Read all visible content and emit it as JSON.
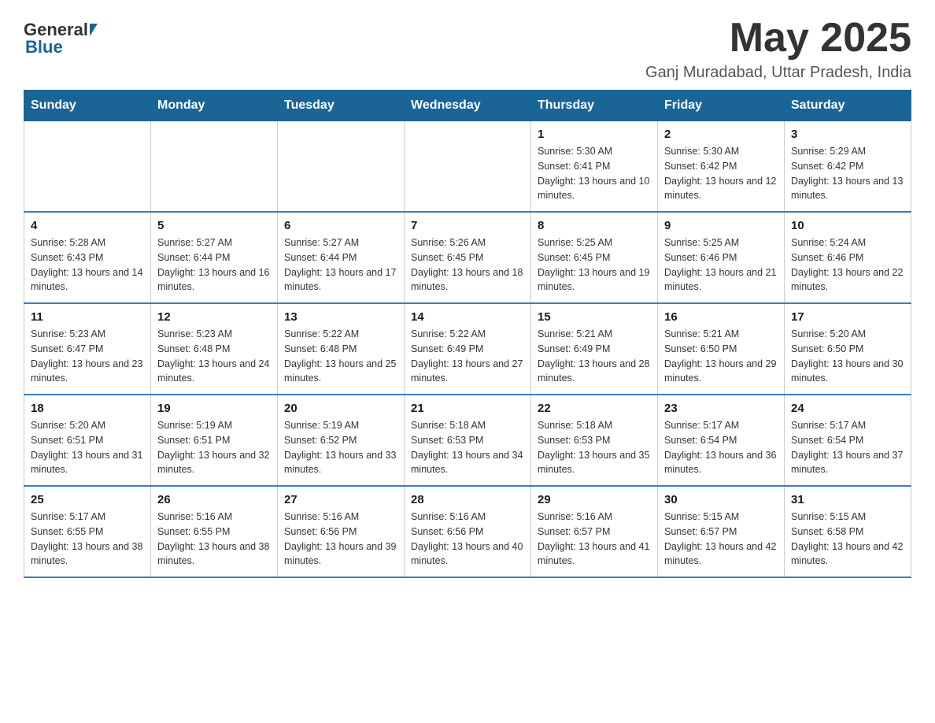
{
  "header": {
    "logo": {
      "general": "General",
      "blue": "Blue"
    },
    "title": "May 2025",
    "location": "Ganj Muradabad, Uttar Pradesh, India"
  },
  "days_of_week": [
    "Sunday",
    "Monday",
    "Tuesday",
    "Wednesday",
    "Thursday",
    "Friday",
    "Saturday"
  ],
  "weeks": [
    [
      {
        "day": "",
        "info": ""
      },
      {
        "day": "",
        "info": ""
      },
      {
        "day": "",
        "info": ""
      },
      {
        "day": "",
        "info": ""
      },
      {
        "day": "1",
        "info": "Sunrise: 5:30 AM\nSunset: 6:41 PM\nDaylight: 13 hours and 10 minutes."
      },
      {
        "day": "2",
        "info": "Sunrise: 5:30 AM\nSunset: 6:42 PM\nDaylight: 13 hours and 12 minutes."
      },
      {
        "day": "3",
        "info": "Sunrise: 5:29 AM\nSunset: 6:42 PM\nDaylight: 13 hours and 13 minutes."
      }
    ],
    [
      {
        "day": "4",
        "info": "Sunrise: 5:28 AM\nSunset: 6:43 PM\nDaylight: 13 hours and 14 minutes."
      },
      {
        "day": "5",
        "info": "Sunrise: 5:27 AM\nSunset: 6:44 PM\nDaylight: 13 hours and 16 minutes."
      },
      {
        "day": "6",
        "info": "Sunrise: 5:27 AM\nSunset: 6:44 PM\nDaylight: 13 hours and 17 minutes."
      },
      {
        "day": "7",
        "info": "Sunrise: 5:26 AM\nSunset: 6:45 PM\nDaylight: 13 hours and 18 minutes."
      },
      {
        "day": "8",
        "info": "Sunrise: 5:25 AM\nSunset: 6:45 PM\nDaylight: 13 hours and 19 minutes."
      },
      {
        "day": "9",
        "info": "Sunrise: 5:25 AM\nSunset: 6:46 PM\nDaylight: 13 hours and 21 minutes."
      },
      {
        "day": "10",
        "info": "Sunrise: 5:24 AM\nSunset: 6:46 PM\nDaylight: 13 hours and 22 minutes."
      }
    ],
    [
      {
        "day": "11",
        "info": "Sunrise: 5:23 AM\nSunset: 6:47 PM\nDaylight: 13 hours and 23 minutes."
      },
      {
        "day": "12",
        "info": "Sunrise: 5:23 AM\nSunset: 6:48 PM\nDaylight: 13 hours and 24 minutes."
      },
      {
        "day": "13",
        "info": "Sunrise: 5:22 AM\nSunset: 6:48 PM\nDaylight: 13 hours and 25 minutes."
      },
      {
        "day": "14",
        "info": "Sunrise: 5:22 AM\nSunset: 6:49 PM\nDaylight: 13 hours and 27 minutes."
      },
      {
        "day": "15",
        "info": "Sunrise: 5:21 AM\nSunset: 6:49 PM\nDaylight: 13 hours and 28 minutes."
      },
      {
        "day": "16",
        "info": "Sunrise: 5:21 AM\nSunset: 6:50 PM\nDaylight: 13 hours and 29 minutes."
      },
      {
        "day": "17",
        "info": "Sunrise: 5:20 AM\nSunset: 6:50 PM\nDaylight: 13 hours and 30 minutes."
      }
    ],
    [
      {
        "day": "18",
        "info": "Sunrise: 5:20 AM\nSunset: 6:51 PM\nDaylight: 13 hours and 31 minutes."
      },
      {
        "day": "19",
        "info": "Sunrise: 5:19 AM\nSunset: 6:51 PM\nDaylight: 13 hours and 32 minutes."
      },
      {
        "day": "20",
        "info": "Sunrise: 5:19 AM\nSunset: 6:52 PM\nDaylight: 13 hours and 33 minutes."
      },
      {
        "day": "21",
        "info": "Sunrise: 5:18 AM\nSunset: 6:53 PM\nDaylight: 13 hours and 34 minutes."
      },
      {
        "day": "22",
        "info": "Sunrise: 5:18 AM\nSunset: 6:53 PM\nDaylight: 13 hours and 35 minutes."
      },
      {
        "day": "23",
        "info": "Sunrise: 5:17 AM\nSunset: 6:54 PM\nDaylight: 13 hours and 36 minutes."
      },
      {
        "day": "24",
        "info": "Sunrise: 5:17 AM\nSunset: 6:54 PM\nDaylight: 13 hours and 37 minutes."
      }
    ],
    [
      {
        "day": "25",
        "info": "Sunrise: 5:17 AM\nSunset: 6:55 PM\nDaylight: 13 hours and 38 minutes."
      },
      {
        "day": "26",
        "info": "Sunrise: 5:16 AM\nSunset: 6:55 PM\nDaylight: 13 hours and 38 minutes."
      },
      {
        "day": "27",
        "info": "Sunrise: 5:16 AM\nSunset: 6:56 PM\nDaylight: 13 hours and 39 minutes."
      },
      {
        "day": "28",
        "info": "Sunrise: 5:16 AM\nSunset: 6:56 PM\nDaylight: 13 hours and 40 minutes."
      },
      {
        "day": "29",
        "info": "Sunrise: 5:16 AM\nSunset: 6:57 PM\nDaylight: 13 hours and 41 minutes."
      },
      {
        "day": "30",
        "info": "Sunrise: 5:15 AM\nSunset: 6:57 PM\nDaylight: 13 hours and 42 minutes."
      },
      {
        "day": "31",
        "info": "Sunrise: 5:15 AM\nSunset: 6:58 PM\nDaylight: 13 hours and 42 minutes."
      }
    ]
  ]
}
